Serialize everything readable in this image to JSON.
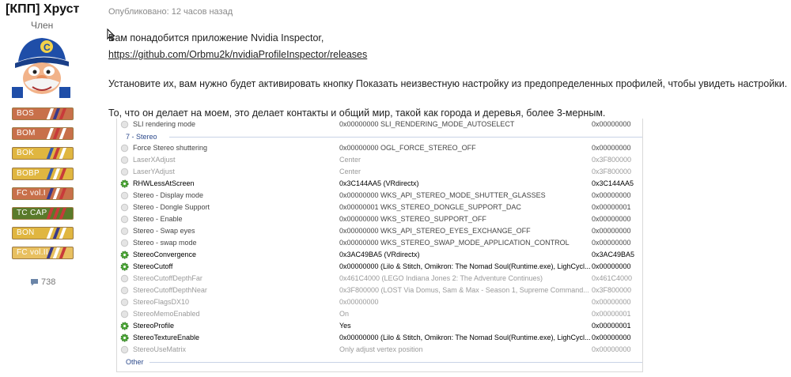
{
  "author": {
    "name": "[КПП] Хруст",
    "role": "Член",
    "posts": "738"
  },
  "badges": [
    {
      "label": "BOS",
      "color": "#c8704a",
      "stripes": [
        "#ffffff",
        "#3a3a8a",
        "#c83a3a"
      ]
    },
    {
      "label": "BOM",
      "color": "#c8704a",
      "stripes": [
        "#ffffff",
        "#c83a3a",
        "#ffffff"
      ]
    },
    {
      "label": "BOK",
      "color": "#e0b640",
      "stripes": [
        "#3a5aaa",
        "#c83a3a",
        "#ffffff"
      ]
    },
    {
      "label": "BOBP",
      "color": "#e0b640",
      "stripes": [
        "#3a5aaa",
        "#ffffff",
        "#c83a3a"
      ]
    },
    {
      "label": "FC vol.I",
      "color": "#c8704a",
      "stripes": [
        "#3a3a8a",
        "#ffffff",
        "#c83a3a"
      ]
    },
    {
      "label": "TC CAP",
      "color": "#5a7a2a",
      "stripes": [
        "#c83a3a",
        "#c83a3a",
        "#c83a3a"
      ]
    },
    {
      "label": "BON",
      "color": "#e0b640",
      "stripes": [
        "#ffffff",
        "#3a3a8a",
        "#ffffff"
      ]
    },
    {
      "label": "FC vol.II",
      "color": "#e8c060",
      "stripes": [
        "#3a3a8a",
        "#ffffff",
        "#c83a3a"
      ]
    }
  ],
  "post": {
    "published": "Опубликовано: 12 часов назад",
    "line1": "Вам понадобится приложение Nvidia Inspector,",
    "link": "https://github.com/Orbmu2k/nvidiaProfileInspector/releases",
    "line2": "Установите их, вам нужно будет активировать кнопку Показать неизвестную настройку из предопределенных профилей, чтобы увидеть настройки.",
    "line3": "То, что он делает на моем, это делает контакты и общий мир, такой как города и деревья, более 3-мерным."
  },
  "inspector": {
    "rows": [
      {
        "type": "row",
        "name": "SLI rendering mode",
        "value": "0x00000000 SLI_RENDERING_MODE_AUTOSELECT",
        "hex": "0x00000000",
        "state": "normal"
      },
      {
        "type": "section",
        "name": "7 - Stereo"
      },
      {
        "type": "row",
        "name": "Force Stereo shuttering",
        "value": "0x00000000 OGL_FORCE_STEREO_OFF",
        "hex": "0x00000000",
        "state": "normal"
      },
      {
        "type": "row",
        "name": "LaserXAdjust",
        "value": "Center",
        "hex": "0x3F800000",
        "state": "muted"
      },
      {
        "type": "row",
        "name": "LaserYAdjust",
        "value": "Center",
        "hex": "0x3F800000",
        "state": "muted"
      },
      {
        "type": "row",
        "name": "RHWLessAtScreen",
        "value": "0x3C144AA5 (VRdirectx)",
        "hex": "0x3C144AA5",
        "state": "active"
      },
      {
        "type": "row",
        "name": "Stereo - Display mode",
        "value": "0x00000000 WKS_API_STEREO_MODE_SHUTTER_GLASSES",
        "hex": "0x00000000",
        "state": "normal"
      },
      {
        "type": "row",
        "name": "Stereo - Dongle Support",
        "value": "0x00000001 WKS_STEREO_DONGLE_SUPPORT_DAC",
        "hex": "0x00000001",
        "state": "normal"
      },
      {
        "type": "row",
        "name": "Stereo - Enable",
        "value": "0x00000000 WKS_STEREO_SUPPORT_OFF",
        "hex": "0x00000000",
        "state": "normal"
      },
      {
        "type": "row",
        "name": "Stereo - Swap eyes",
        "value": "0x00000000 WKS_API_STEREO_EYES_EXCHANGE_OFF",
        "hex": "0x00000000",
        "state": "normal"
      },
      {
        "type": "row",
        "name": "Stereo - swap mode",
        "value": "0x00000000 WKS_STEREO_SWAP_MODE_APPLICATION_CONTROL",
        "hex": "0x00000000",
        "state": "normal"
      },
      {
        "type": "row",
        "name": "StereoConvergence",
        "value": "0x3AC49BA5 (VRdirectx)",
        "hex": "0x3AC49BA5",
        "state": "active"
      },
      {
        "type": "row",
        "name": "StereoCutoff",
        "value": "0x00000000 (Lilo & Stitch, Omikron: The Nomad Soul(Runtime.exe), LighCycl...",
        "hex": "0x00000000",
        "state": "active"
      },
      {
        "type": "row",
        "name": "StereoCutoffDepthFar",
        "value": "0x461C4000 (LEGO Indiana Jones 2: The Adventure Continues)",
        "hex": "0x461C4000",
        "state": "muted"
      },
      {
        "type": "row",
        "name": "StereoCutoffDepthNear",
        "value": "0x3F800000 (LOST Via Domus, Sam & Max - Season 1, Supreme Command...",
        "hex": "0x3F800000",
        "state": "muted"
      },
      {
        "type": "row",
        "name": "StereoFlagsDX10",
        "value": "0x00000000",
        "hex": "0x00000000",
        "state": "muted"
      },
      {
        "type": "row",
        "name": "StereoMemoEnabled",
        "value": "On",
        "hex": "0x00000001",
        "state": "muted"
      },
      {
        "type": "row",
        "name": "StereoProfile",
        "value": "Yes",
        "hex": "0x00000001",
        "state": "active"
      },
      {
        "type": "row",
        "name": "StereoTextureEnable",
        "value": "0x00000000 (Lilo & Stitch, Omikron: The Nomad Soul(Runtime.exe), LighCycl...",
        "hex": "0x00000000",
        "state": "active"
      },
      {
        "type": "row",
        "name": "StereoUseMatrix",
        "value": "Only adjust vertex position",
        "hex": "0x00000000",
        "state": "muted"
      },
      {
        "type": "section",
        "name": "Other"
      }
    ]
  }
}
